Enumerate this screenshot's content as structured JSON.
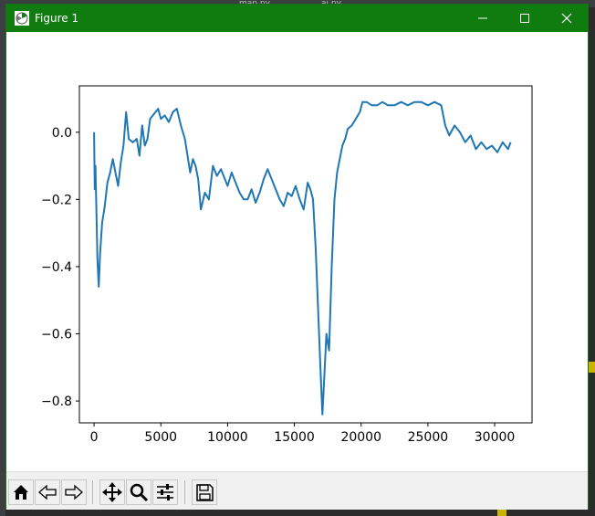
{
  "window": {
    "title": "Figure 1"
  },
  "background": {
    "tabs": [
      "map.py",
      "ai.py"
    ]
  },
  "toolbar": {
    "buttons": [
      "home-icon",
      "back-icon",
      "forward-icon",
      "pan-icon",
      "zoom-icon",
      "configure-subplots-icon",
      "save-icon"
    ]
  },
  "chart_data": {
    "type": "line",
    "title": "",
    "xlabel": "",
    "ylabel": "",
    "xlim": [
      -1100,
      32800
    ],
    "ylim": [
      -0.865,
      0.138
    ],
    "xticks": [
      0,
      5000,
      10000,
      15000,
      20000,
      25000,
      30000
    ],
    "xtick_labels": [
      "0",
      "5000",
      "10000",
      "15000",
      "20000",
      "25000",
      "30000"
    ],
    "yticks": [
      0.0,
      -0.2,
      -0.4,
      -0.6,
      -0.8
    ],
    "ytick_labels": [
      "0.0",
      "−0.2",
      "−0.4",
      "−0.6",
      "−0.8"
    ],
    "grid": false,
    "series": [
      {
        "color": "#1f77b4",
        "x": [
          0,
          50,
          100,
          150,
          250,
          350,
          450,
          600,
          800,
          1000,
          1200,
          1400,
          1600,
          1800,
          2000,
          2200,
          2400,
          2600,
          2900,
          3200,
          3400,
          3600,
          3800,
          4000,
          4200,
          4400,
          4600,
          4800,
          5000,
          5300,
          5600,
          5900,
          6200,
          6500,
          6800,
          7000,
          7200,
          7400,
          7600,
          7800,
          8000,
          8300,
          8600,
          8900,
          9200,
          9500,
          9800,
          10000,
          10300,
          10600,
          10900,
          11200,
          11500,
          11800,
          12100,
          12400,
          12700,
          13000,
          13300,
          13600,
          13900,
          14200,
          14500,
          14800,
          15100,
          15400,
          15700,
          16000,
          16200,
          16400,
          16600,
          16800,
          16950,
          17100,
          17250,
          17400,
          17600,
          17800,
          18000,
          18200,
          18400,
          18600,
          18800,
          19000,
          19300,
          19600,
          19900,
          20100,
          20400,
          20800,
          21200,
          21600,
          22000,
          22500,
          23000,
          23500,
          24000,
          24500,
          25000,
          25500,
          26000,
          26300,
          26600,
          27000,
          27400,
          27800,
          28200,
          28600,
          29000,
          29400,
          29800,
          30200,
          30600,
          31000,
          31200
        ],
        "y": [
          0.0,
          -0.17,
          -0.1,
          -0.19,
          -0.38,
          -0.46,
          -0.36,
          -0.27,
          -0.22,
          -0.15,
          -0.12,
          -0.08,
          -0.12,
          -0.16,
          -0.09,
          -0.04,
          0.06,
          -0.02,
          -0.03,
          -0.02,
          -0.07,
          0.02,
          -0.04,
          -0.02,
          0.04,
          0.05,
          0.06,
          0.07,
          0.04,
          0.05,
          0.03,
          0.06,
          0.07,
          0.02,
          -0.02,
          -0.07,
          -0.12,
          -0.08,
          -0.1,
          -0.14,
          -0.23,
          -0.18,
          -0.2,
          -0.1,
          -0.13,
          -0.11,
          -0.14,
          -0.16,
          -0.12,
          -0.15,
          -0.18,
          -0.2,
          -0.2,
          -0.17,
          -0.21,
          -0.18,
          -0.14,
          -0.11,
          -0.14,
          -0.17,
          -0.2,
          -0.22,
          -0.18,
          -0.19,
          -0.16,
          -0.2,
          -0.23,
          -0.15,
          -0.17,
          -0.2,
          -0.35,
          -0.55,
          -0.7,
          -0.84,
          -0.72,
          -0.6,
          -0.65,
          -0.4,
          -0.2,
          -0.12,
          -0.08,
          -0.04,
          -0.02,
          0.01,
          0.02,
          0.04,
          0.06,
          0.09,
          0.09,
          0.08,
          0.08,
          0.09,
          0.08,
          0.08,
          0.09,
          0.08,
          0.09,
          0.09,
          0.08,
          0.09,
          0.08,
          0.02,
          -0.01,
          0.02,
          0.0,
          -0.03,
          -0.01,
          -0.05,
          -0.03,
          -0.05,
          -0.04,
          -0.06,
          -0.03,
          -0.05,
          -0.03
        ]
      }
    ]
  }
}
